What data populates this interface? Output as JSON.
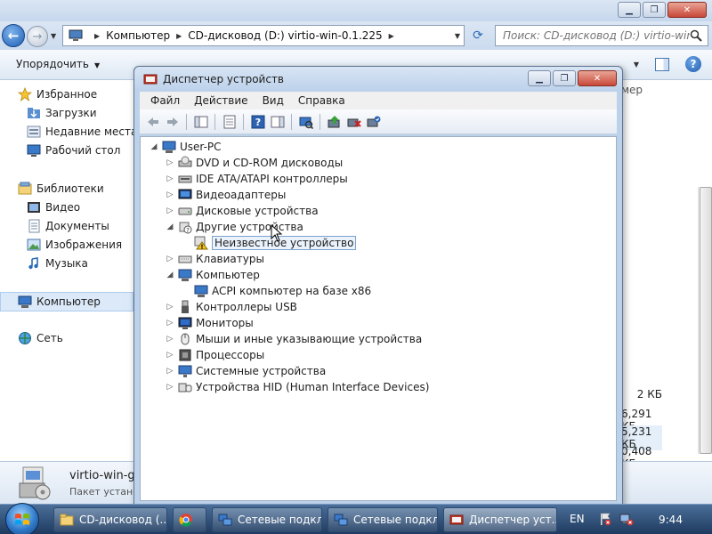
{
  "explorer": {
    "address": {
      "crumbs": [
        "Компьютер",
        "CD-дисковод (D:) virtio-win-0.1.225"
      ]
    },
    "search": {
      "placeholder": "Поиск: CD-дисковод (D:) virtio-win-0..."
    },
    "toolbar": {
      "organize_label": "Упорядочить"
    },
    "nav": {
      "favorites_label": "Избранное",
      "favorites": [
        "Загрузки",
        "Недавние места",
        "Рабочий стол"
      ],
      "libraries_label": "Библиотеки",
      "libraries": [
        "Видео",
        "Документы",
        "Изображения",
        "Музыка"
      ],
      "computer_label": "Компьютер",
      "network_label": "Сеть"
    },
    "filelist": {
      "header_fragment": "мер",
      "sizes": [
        "2 КБ",
        "6,291 КБ",
        "5,231 КБ",
        "0,408 КБ"
      ]
    },
    "details": {
      "name": "virtio-win-gt-",
      "type": "Пакет устано"
    }
  },
  "devmgr": {
    "title": "Диспетчер устройств",
    "menu": [
      "Файл",
      "Действие",
      "Вид",
      "Справка"
    ],
    "tree": {
      "root": "User-PC",
      "nodes": [
        "DVD и CD-ROM дисководы",
        "IDE ATA/ATAPI контроллеры",
        "Видеоадаптеры",
        "Дисковые устройства",
        "Другие устройства",
        "Неизвестное устройство",
        "Клавиатуры",
        "Компьютер",
        "ACPI компьютер на базе x86",
        "Контроллеры USB",
        "Мониторы",
        "Мыши и иные указывающие устройства",
        "Процессоры",
        "Системные устройства",
        "Устройства HID (Human Interface Devices)"
      ]
    }
  },
  "taskbar": {
    "tasks": [
      "CD-дисковод (...",
      "Сетевые подкл...",
      "Сетевые подкл...",
      "Диспетчер уст..."
    ],
    "lang": "EN",
    "clock": "9:44"
  },
  "colors": {
    "taskbar": "#1f3a5f",
    "selection": "#dbe9f9",
    "warning": "#f2c318"
  }
}
